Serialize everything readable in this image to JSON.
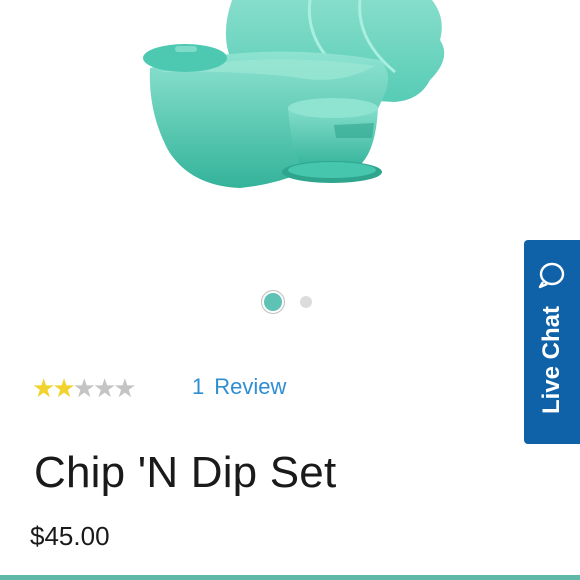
{
  "product": {
    "title": "Chip 'N Dip Set",
    "price": "$45.00",
    "image": {
      "icon": "chip-n-dip-product-photo",
      "colors": {
        "main": "#45c6ad",
        "light": "#7fdcc8",
        "dark": "#2fa58e"
      }
    }
  },
  "carousel": {
    "total": 2,
    "active": 1,
    "active_color": "#5ec3b4"
  },
  "rating": {
    "value": 2,
    "max": 5,
    "review_count": "1",
    "review_label": "Review"
  },
  "live_chat": {
    "label": "Live Chat",
    "icon": "chat-bubble-icon",
    "color": "#1062a8"
  },
  "accent_line_color": "#5fb8a8"
}
